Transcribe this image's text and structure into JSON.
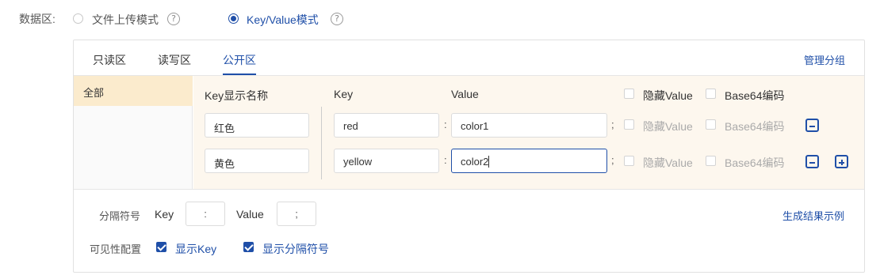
{
  "mode_row": {
    "label": "数据区:",
    "options": [
      {
        "label": "文件上传模式",
        "selected": false
      },
      {
        "label": "Key/Value模式",
        "selected": true
      }
    ],
    "help_glyph": "?"
  },
  "tabs": [
    "只读区",
    "读写区",
    "公开区"
  ],
  "active_tab": "公开区",
  "manage_groups_link": "管理分组",
  "groups": [
    {
      "label": "全部",
      "selected": true
    }
  ],
  "columns": {
    "key_display_name": "Key显示名称",
    "key": "Key",
    "value": "Value",
    "hide_value": "隐藏Value",
    "base64": "Base64编码"
  },
  "rows": [
    {
      "display_name": "红色",
      "key": "red",
      "key_sep": ":",
      "value": "color1",
      "pair_sep": ";",
      "hide_value": "隐藏Value",
      "base64": "Base64编码",
      "hide_checked": false,
      "base64_checked": false,
      "focused": false
    },
    {
      "display_name": "黄色",
      "key": "yellow",
      "key_sep": ":",
      "value": "color2",
      "pair_sep": ";",
      "hide_value": "隐藏Value",
      "base64": "Base64编码",
      "hide_checked": false,
      "base64_checked": false,
      "focused": true
    }
  ],
  "separator_settings": {
    "label": "分隔符号",
    "key_label": "Key",
    "key_value": ":",
    "value_label": "Value",
    "value_value": ";"
  },
  "generate_example_link": "生成结果示例",
  "visibility": {
    "label": "可见性配置",
    "options": [
      {
        "label": "显示Key",
        "checked": true
      },
      {
        "label": "显示分隔符号",
        "checked": true
      }
    ]
  },
  "icons": {
    "help": "question-circle-icon",
    "remove": "minus-square-icon",
    "add": "plus-square-icon"
  },
  "colors": {
    "accent": "#1f4fa8",
    "selected_group_bg": "#fbebcd",
    "kv_area_bg": "#fdf7ee"
  }
}
